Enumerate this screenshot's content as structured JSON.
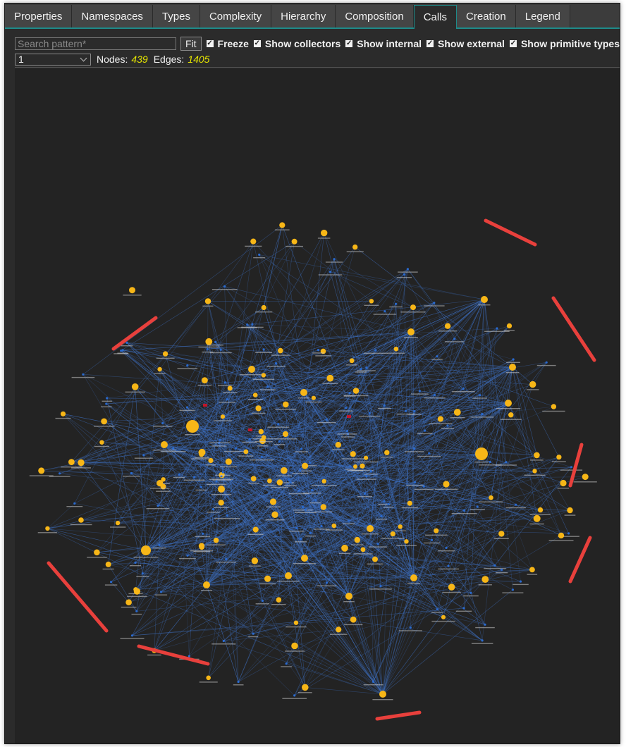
{
  "tabs": [
    {
      "label": "Properties",
      "active": false
    },
    {
      "label": "Namespaces",
      "active": false
    },
    {
      "label": "Types",
      "active": false
    },
    {
      "label": "Complexity",
      "active": false
    },
    {
      "label": "Hierarchy",
      "active": false
    },
    {
      "label": "Composition",
      "active": false
    },
    {
      "label": "Calls",
      "active": true
    },
    {
      "label": "Creation",
      "active": false
    },
    {
      "label": "Legend",
      "active": false
    }
  ],
  "toolbar": {
    "search_placeholder": "Search pattern*",
    "search_value": "",
    "fit_label": "Fit",
    "options": [
      {
        "label": "Freeze",
        "checked": true
      },
      {
        "label": "Show collectors",
        "checked": true
      },
      {
        "label": "Show internal",
        "checked": true
      },
      {
        "label": "Show external",
        "checked": true
      },
      {
        "label": "Show primitive types",
        "checked": true
      }
    ]
  },
  "stats": {
    "level_value": "1",
    "nodes_label": "Nodes:",
    "nodes_value": "439",
    "edges_label": "Edges:",
    "edges_value": "1405"
  },
  "graph": {
    "node_color": "#f7b617",
    "external_node_color": "#2a6bd1",
    "edge_color": "#3f73c8",
    "highlight_node_color": "#c0162a",
    "annotation_color": "#e8403c",
    "background": "#232323"
  }
}
